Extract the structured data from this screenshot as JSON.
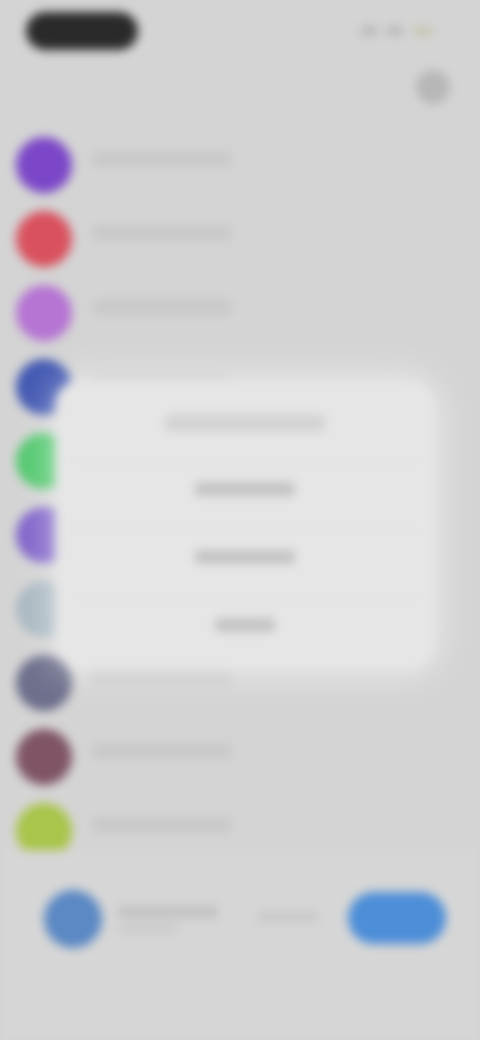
{
  "status_bar": {
    "time": "",
    "colors": {
      "pill": "#2a2a2a",
      "battery": "#c9c6b4"
    }
  },
  "nav": {
    "title": "",
    "action_icon": "profile-icon"
  },
  "list": {
    "items": [
      {
        "label": "",
        "color": "#7b47c8"
      },
      {
        "label": "",
        "color": "#d9515e"
      },
      {
        "label": "",
        "color": "#b674d3"
      },
      {
        "label": "",
        "color": "#4258b2"
      },
      {
        "label": "",
        "color": "#52c86e"
      },
      {
        "label": "",
        "color": "#8064ca"
      },
      {
        "label": "",
        "color": "#a9b8c1"
      },
      {
        "label": "",
        "color": "#6d6f8c"
      },
      {
        "label": "",
        "color": "#7f5466"
      },
      {
        "label": "",
        "color": "#a9c54a"
      }
    ]
  },
  "dialog": {
    "title": "",
    "options": [
      {
        "label": ""
      },
      {
        "label": ""
      },
      {
        "label": ""
      }
    ]
  },
  "bottom_bar": {
    "name": "",
    "subtitle": "",
    "middle": "",
    "primary_label": "",
    "colors": {
      "avatar": "#5b89c4",
      "primary": "#4d8ed8"
    }
  }
}
